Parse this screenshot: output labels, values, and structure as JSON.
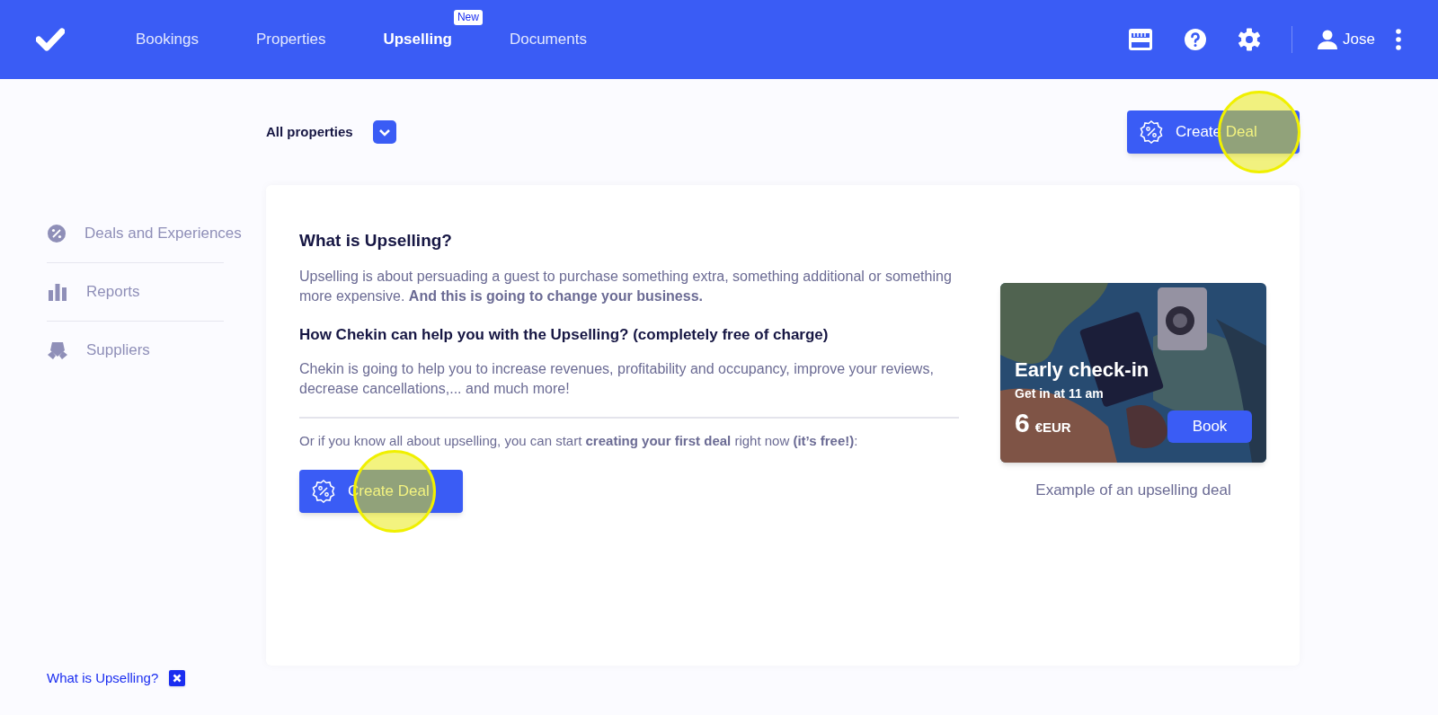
{
  "nav": {
    "items": [
      {
        "label": "Bookings",
        "selected": false
      },
      {
        "label": "Properties",
        "selected": false
      },
      {
        "label": "Upselling",
        "selected": true,
        "badge": "New"
      },
      {
        "label": "Documents",
        "selected": false
      }
    ],
    "user": "Jose"
  },
  "filter": {
    "value": "All properties"
  },
  "top_button": {
    "label": "Create Deal",
    "highlighted": true
  },
  "sidebar": {
    "items": [
      {
        "label": "Deals and Experiences",
        "kind": "deals"
      },
      {
        "label": "Reports",
        "kind": "reports"
      },
      {
        "label": "Suppliers",
        "kind": "suppliers"
      }
    ],
    "help_link": "What is Upselling?"
  },
  "content": {
    "title": "What is Upselling?",
    "paragraph_1": "Upselling is about persuading a guest to purchase something extra, something additional or something more expensive. **And this is going to change your business.**",
    "subtitle": "How Chekin can help you with the Upselling? (completely free of charge)",
    "paragraph_2": "Chekin is going to help you to increase revenues, profitability and occupancy, improve your reviews, decrease cancellations,... and much more!",
    "paragraph_3": "Or if you know all about upselling, you can start **creating your first deal** right now **(it’s free!)**:",
    "button": {
      "label": "Create Deal",
      "highlighted": true
    }
  },
  "example": {
    "title": "Early check-in",
    "subtitle": "Get in at 11 am",
    "price": "6",
    "currency": "€EUR",
    "button": "Book",
    "caption": "Example of an upselling deal"
  }
}
